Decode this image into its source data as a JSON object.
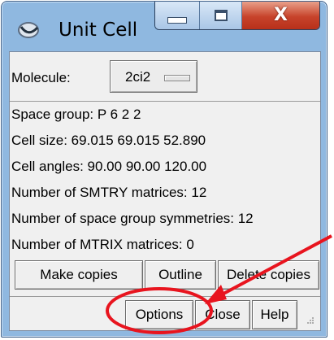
{
  "window": {
    "title": "Unit Cell",
    "icons": {
      "app": "unit-cell-app-icon",
      "minimize": "minimize-icon",
      "maximize": "maximize-icon",
      "close": "close-icon"
    },
    "close_glyph": "X"
  },
  "molecule": {
    "label": "Molecule:",
    "value": "2ci2"
  },
  "info": {
    "space_group": "Space group: P 6 2 2",
    "cell_size": "Cell size:  69.015  69.015  52.890",
    "cell_angles": "Cell angles:  90.00  90.00  120.00",
    "smtry": "Number of SMTRY matrices: 12",
    "sym": "Number of space group symmetries: 12",
    "mtrix": "Number of MTRIX matrices: 0"
  },
  "buttons_row1": {
    "make_copies": "Make copies",
    "outline": "Outline",
    "delete_copies": "Delete copies"
  },
  "buttons_row2": {
    "options": "Options",
    "close": "Close",
    "help": "Help"
  },
  "annotation": {
    "color": "#e8141e"
  }
}
